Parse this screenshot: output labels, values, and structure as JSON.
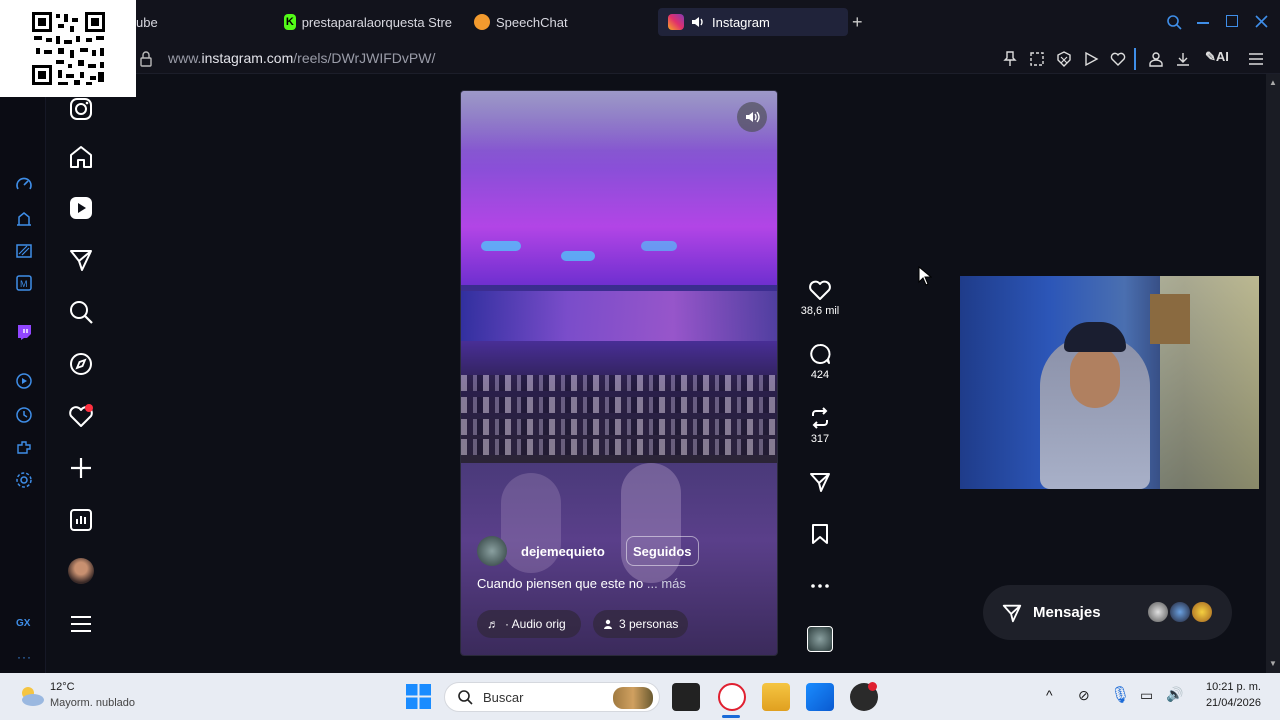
{
  "browser": {
    "tabs": [
      {
        "label": "ube"
      },
      {
        "label": "prestaparalaorquesta Stre"
      },
      {
        "label": "SpeechChat"
      },
      {
        "label": "Instagram"
      }
    ],
    "url_prefix": "www.",
    "url_domain": "instagram.com",
    "url_path": "/reels/DWrJWIFDvPW/",
    "ai_label": "AI",
    "gx_label": "GX"
  },
  "reel": {
    "username": "dejemequieto",
    "follow_label": "Seguidos",
    "caption": "Cuando piensen que este no",
    "more_label": "... más",
    "audio_label": "· Audio orig",
    "people_label": "3 personas"
  },
  "actions": {
    "likes": "38,6 mil",
    "comments": "424",
    "reposts": "317"
  },
  "messages": {
    "label": "Mensajes"
  },
  "taskbar": {
    "temperature": "12°C",
    "weather": "Mayorm. nublado",
    "search_placeholder": "Buscar",
    "time": "10:21 p. m.",
    "date": "21/04/2026"
  },
  "colors": {
    "accent_blue": "#3f8ee8",
    "notification_red": "#ff3040",
    "active_tab": "#20233a"
  }
}
